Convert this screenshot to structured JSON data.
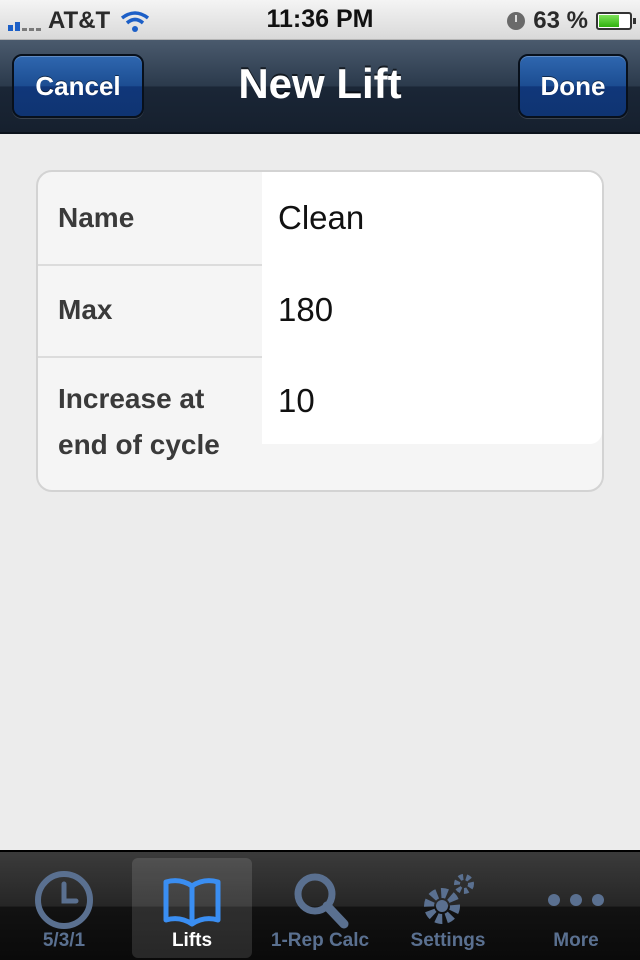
{
  "status_bar": {
    "carrier": "AT&T",
    "time": "11:36 PM",
    "battery_percent": "63 %",
    "battery_level": 0.63
  },
  "nav": {
    "title": "New Lift",
    "cancel_label": "Cancel",
    "done_label": "Done"
  },
  "form": {
    "name_label": "Name",
    "name_value": "Clean",
    "max_label": "Max",
    "max_value": "180",
    "increase_label": "Increase at end of cycle",
    "increase_value": "10"
  },
  "tabs": [
    {
      "label": "5/3/1",
      "icon": "clock-icon",
      "active": false
    },
    {
      "label": "Lifts",
      "icon": "book-icon",
      "active": true
    },
    {
      "label": "1-Rep Calc",
      "icon": "magnifier-icon",
      "active": false
    },
    {
      "label": "Settings",
      "icon": "gears-icon",
      "active": false
    },
    {
      "label": "More",
      "icon": "more-dots-icon",
      "active": false
    }
  ],
  "colors": {
    "tab_inactive": "#5a7090",
    "tab_active": "#3a8ef2",
    "nav_button": "#1c4d92"
  }
}
